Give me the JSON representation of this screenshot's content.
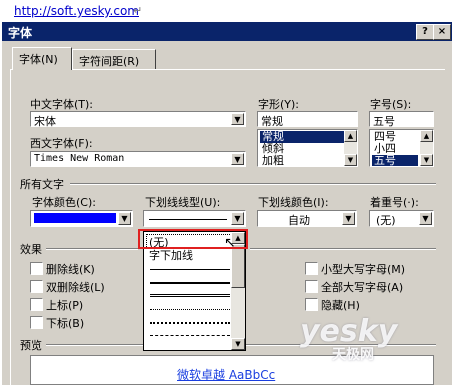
{
  "top": {
    "url": "http://soft.yesky.com",
    "mark": "↵"
  },
  "window": {
    "title": "字体",
    "help": "?",
    "close": "×"
  },
  "tabs": [
    {
      "label": "字体(N)"
    },
    {
      "label": "字符间距(R)"
    }
  ],
  "fonts": {
    "chinese_label": "中文字体(T):",
    "chinese_value": "宋体",
    "western_label": "西文字体(F):",
    "western_value": "Times New Roman",
    "style_label": "字形(Y):",
    "style_value": "常规",
    "style_options": [
      "常规",
      "倾斜",
      "加粗"
    ],
    "size_label": "字号(S):",
    "size_value": "五号",
    "size_options": [
      "四号",
      "小四",
      "五号"
    ]
  },
  "all_text": {
    "section_label": "所有文字",
    "font_color_label": "字体颜色(C):",
    "font_color": "#0000ff",
    "underline_type_label": "下划线线型(U):",
    "underline_color_label": "下划线颜色(I):",
    "underline_color_value": "自动",
    "emphasis_label": "着重号(·):",
    "emphasis_value": "(无)"
  },
  "underline_popup": {
    "items": [
      "(无)",
      "字下加线"
    ]
  },
  "effects": {
    "section_label": "效果",
    "left": [
      "删除线(K)",
      "双删除线(L)",
      "上标(P)",
      "下标(B)"
    ],
    "right": [
      "小型大写字母(M)",
      "全部大写字母(A)",
      "隐藏(H)"
    ]
  },
  "preview": {
    "label": "预览",
    "text": "微软卓越  AaBbCc"
  },
  "watermark": {
    "brand": "yesky",
    "sub": "天极网"
  },
  "colors": {
    "title_bar": "#0a246a",
    "dialog_bg": "#d4d0c8",
    "highlight": "#0a246a",
    "red_box": "#e02020"
  }
}
